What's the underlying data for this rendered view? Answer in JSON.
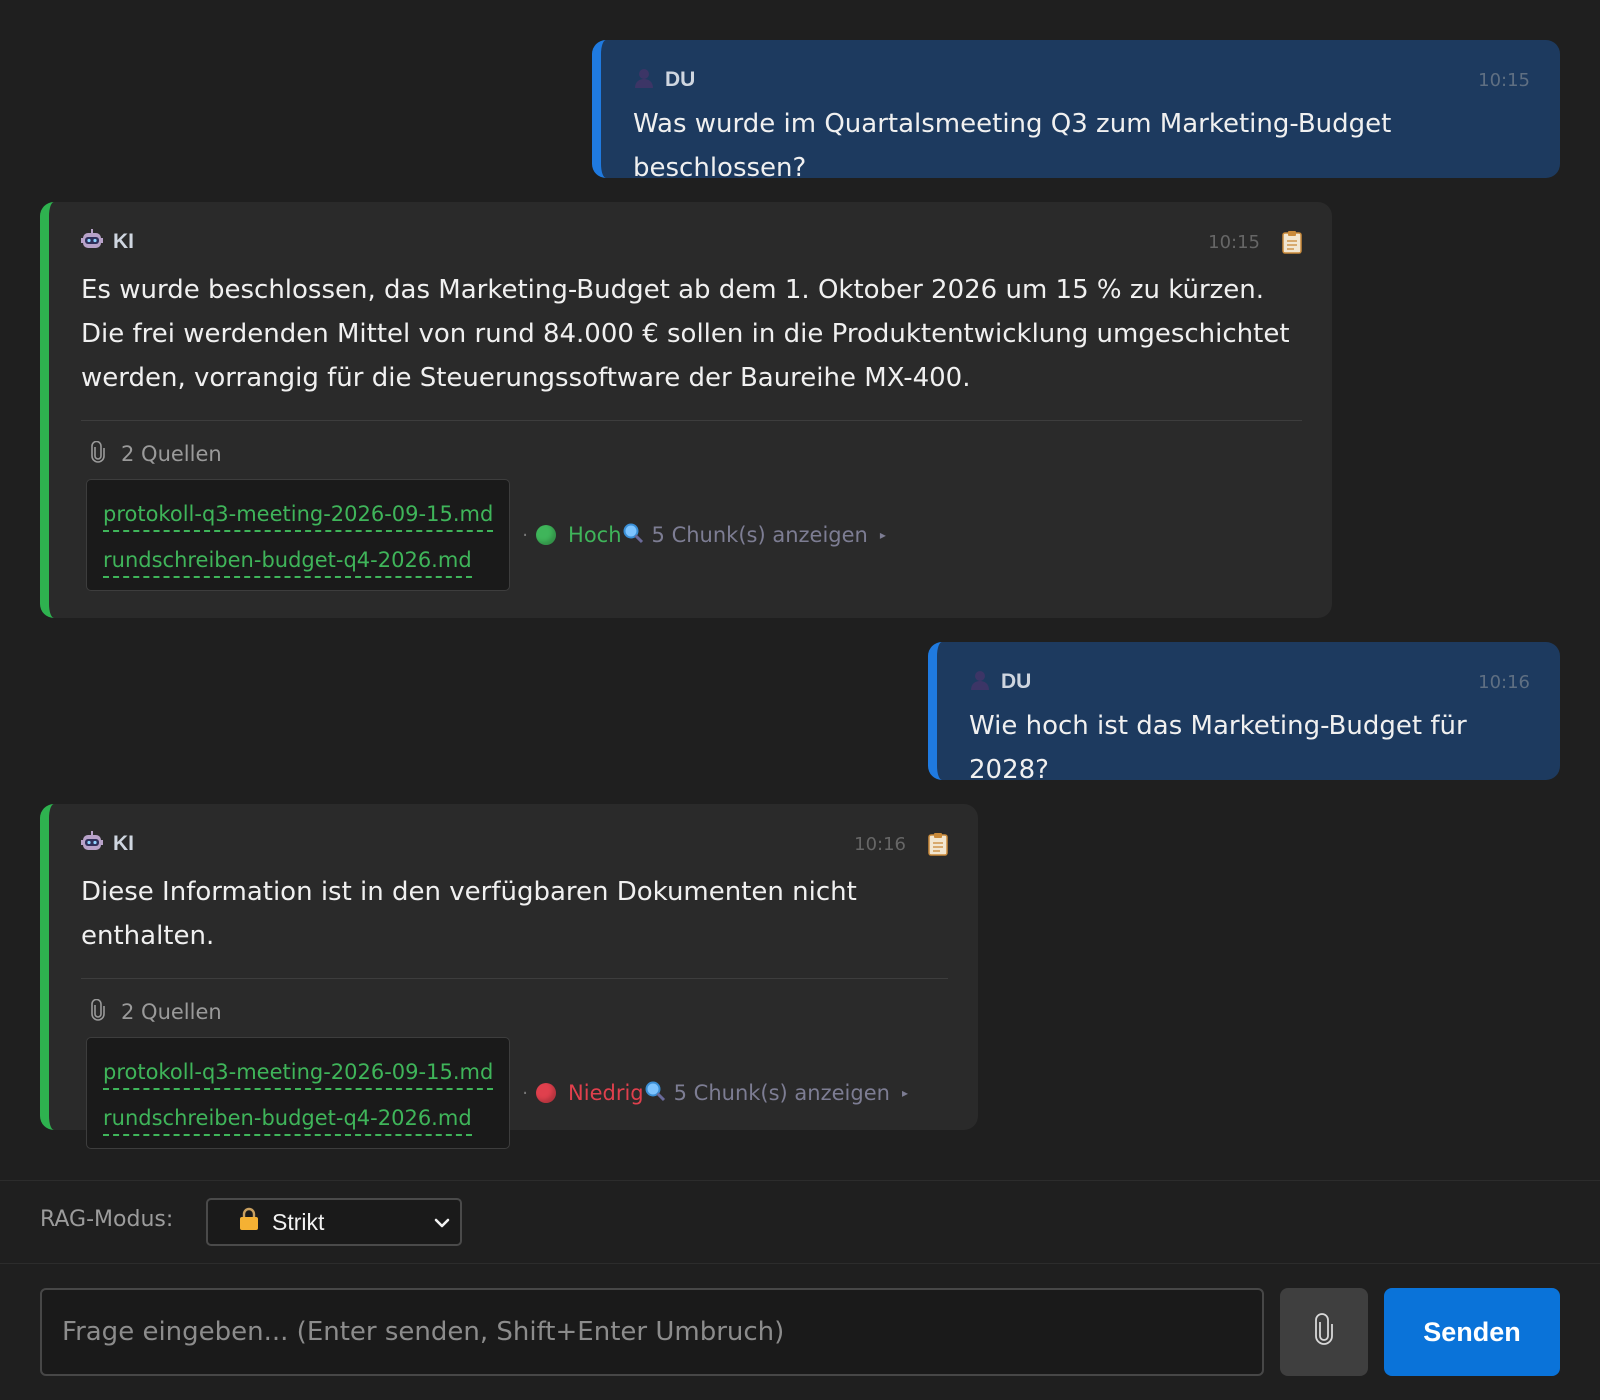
{
  "colors": {
    "user_bubble": "#1d3a5f",
    "user_accent": "#1f7ae0",
    "ai_bubble": "#2a2a2a",
    "ai_accent": "#2eb24f",
    "link_green": "#3fb55a",
    "confidence_high": "#3fb55a",
    "confidence_low": "#e0404d",
    "send_button": "#0a73d9"
  },
  "messages": [
    {
      "role": "user",
      "sender": "DU",
      "time": "10:15",
      "icon": "user-icon",
      "text": "Was wurde im Quartalsmeeting Q3 zum Marketing-Budget beschlossen?"
    },
    {
      "role": "ai",
      "sender": "KI",
      "time": "10:15",
      "icon": "robot-icon",
      "text": "Es wurde beschlossen, das Marketing-Budget ab dem 1. Oktober 2026 um 15 % zu kürzen. Die frei werdenden Mittel von rund 84.000 € sollen in die Produktentwicklung umgeschichtet werden, vorrangig für die Steuerungssoftware der Baureihe MX-400.",
      "sources_label": "2 Quellen",
      "sources": [
        "protokoll-q3-meeting-2026-09-15.md",
        "rundschreiben-budget-q4-2026.md"
      ],
      "separator": "·",
      "confidence": "Hoch",
      "confidence_level": "high",
      "chunks": "5 Chunk(s) anzeigen",
      "caret": "▸"
    },
    {
      "role": "user",
      "sender": "DU",
      "time": "10:16",
      "icon": "user-icon",
      "text": "Wie hoch ist das Marketing-Budget für 2028?"
    },
    {
      "role": "ai",
      "sender": "KI",
      "time": "10:16",
      "icon": "robot-icon",
      "text": "Diese Information ist in den verfügbaren Dokumenten nicht enthalten.",
      "sources_label": "2 Quellen",
      "sources": [
        "protokoll-q3-meeting-2026-09-15.md",
        "rundschreiben-budget-q4-2026.md"
      ],
      "separator": "·",
      "confidence": "Niedrig",
      "confidence_level": "low",
      "chunks": "5 Chunk(s) anzeigen",
      "caret": "▸"
    }
  ],
  "rag": {
    "label": "RAG-Modus:",
    "selected": "Strikt",
    "selected_icon": "lock-icon"
  },
  "composer": {
    "placeholder": "Frage eingeben... (Enter senden, Shift+Enter Umbruch)",
    "attach_icon": "paperclip-icon",
    "send_label": "Senden"
  }
}
